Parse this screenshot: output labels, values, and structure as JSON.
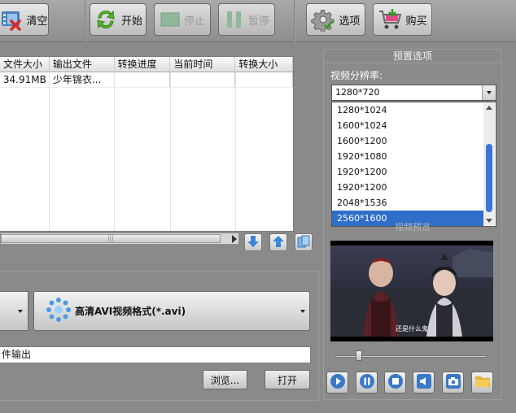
{
  "toolbar": {
    "clear_label": "清空",
    "start_label": "开始",
    "stop_label": "停止",
    "pause_label": "暂停",
    "options_label": "选项",
    "buy_label": "购买"
  },
  "file_list": {
    "columns": [
      "文件大小",
      "输出文件",
      "转换进度",
      "当前时间",
      "转换大小"
    ],
    "rows": [
      {
        "size": "34.91MB",
        "output": "少年锦衣...",
        "progress": "",
        "time": "",
        "out_size": ""
      }
    ]
  },
  "format": {
    "selected": "高清AVI视频格式(*.avi)"
  },
  "output": {
    "path": "件输出",
    "browse_label": "浏览...",
    "open_label": "打开"
  },
  "preview_options": {
    "title": "预置选项",
    "resolution_label": "视频分辨率:",
    "resolution_value": "1280*720",
    "options": [
      "1280*1024",
      "1600*1024",
      "1600*1200",
      "1920*1080",
      "1920*1200",
      "1920*1200",
      "2048*1536",
      "2560*1600"
    ],
    "highlighted_index": 7
  },
  "preview": {
    "label": "视频预览",
    "subtitle": "还是什么鬼"
  },
  "colors": {
    "background": "#8a8a8a",
    "selection": "#2f6ec9",
    "control_icon": "#3a78c8"
  }
}
